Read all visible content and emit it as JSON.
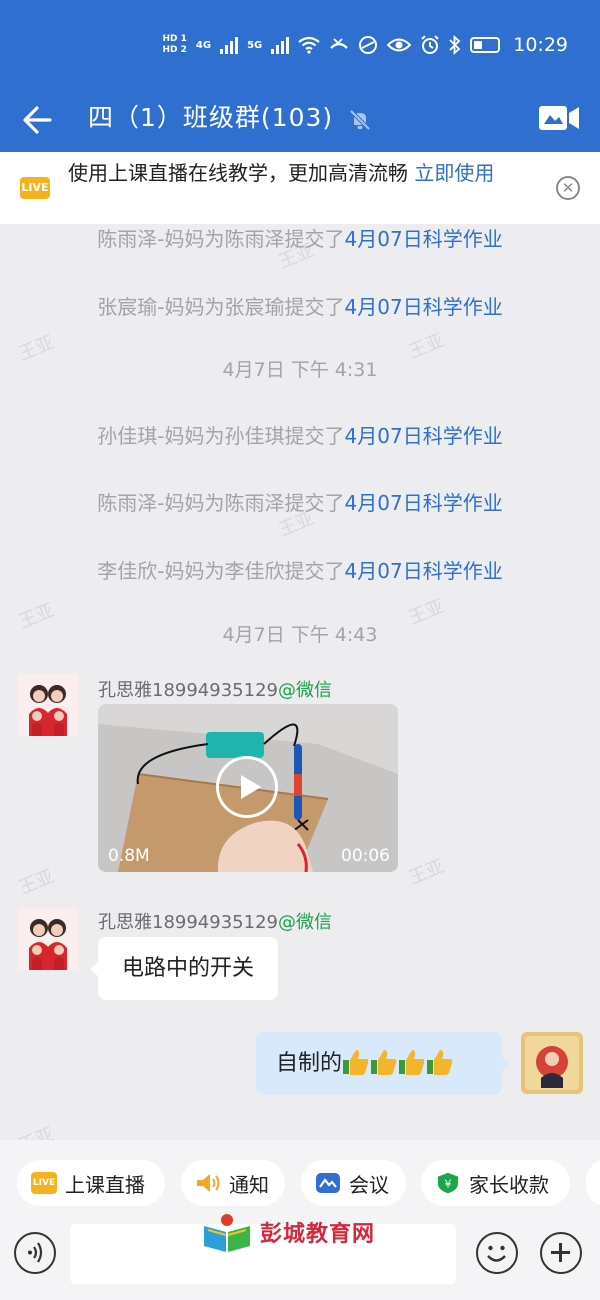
{
  "status_bar": {
    "hd1": "HD 1",
    "hd2": "HD 2",
    "net1": "4G",
    "net2": "5G",
    "time": "10:29"
  },
  "nav": {
    "title": "四（1）班级群(103)"
  },
  "banner": {
    "badge": "LIVE",
    "text": "使用上课直播在线教学，更加高清流畅",
    "action": "立即使用"
  },
  "messages": {
    "sys": [
      {
        "text": "陈雨泽-妈妈为陈雨泽提交了",
        "link": "4月07日科学作业"
      },
      {
        "text": "张宸瑜-妈妈为张宸瑜提交了",
        "link": "4月07日科学作业"
      },
      {
        "text": "孙佳琪-妈妈为孙佳琪提交了",
        "link": "4月07日科学作业"
      },
      {
        "text": "陈雨泽-妈妈为陈雨泽提交了",
        "link": "4月07日科学作业"
      },
      {
        "text": "李佳欣-妈妈为李佳欣提交了",
        "link": "4月07日科学作业"
      }
    ],
    "stamps": [
      "4月7日  下午 4:31",
      "4月7日  下午 4:43"
    ],
    "sender_name": "孔思雅18994935129",
    "sender_source": "@微信",
    "video": {
      "size": "0.8M",
      "duration": "00:06"
    },
    "text_left": "电路中的开关",
    "text_right": "自制的"
  },
  "watermark": "王亚",
  "quick_actions": [
    {
      "label": "上课直播",
      "icon": "live-icon",
      "badge": "LIVE"
    },
    {
      "label": "通知",
      "icon": "speaker-icon"
    },
    {
      "label": "会议",
      "icon": "meeting-icon"
    },
    {
      "label": "家长收款",
      "icon": "payment-shield-icon",
      "glyph": "¥"
    }
  ],
  "site_logo": "彭城教育网",
  "colors": {
    "brand_blue": "#2f6fcf",
    "wechat_green": "#19a34a",
    "live_orange": "#f5b21c"
  }
}
